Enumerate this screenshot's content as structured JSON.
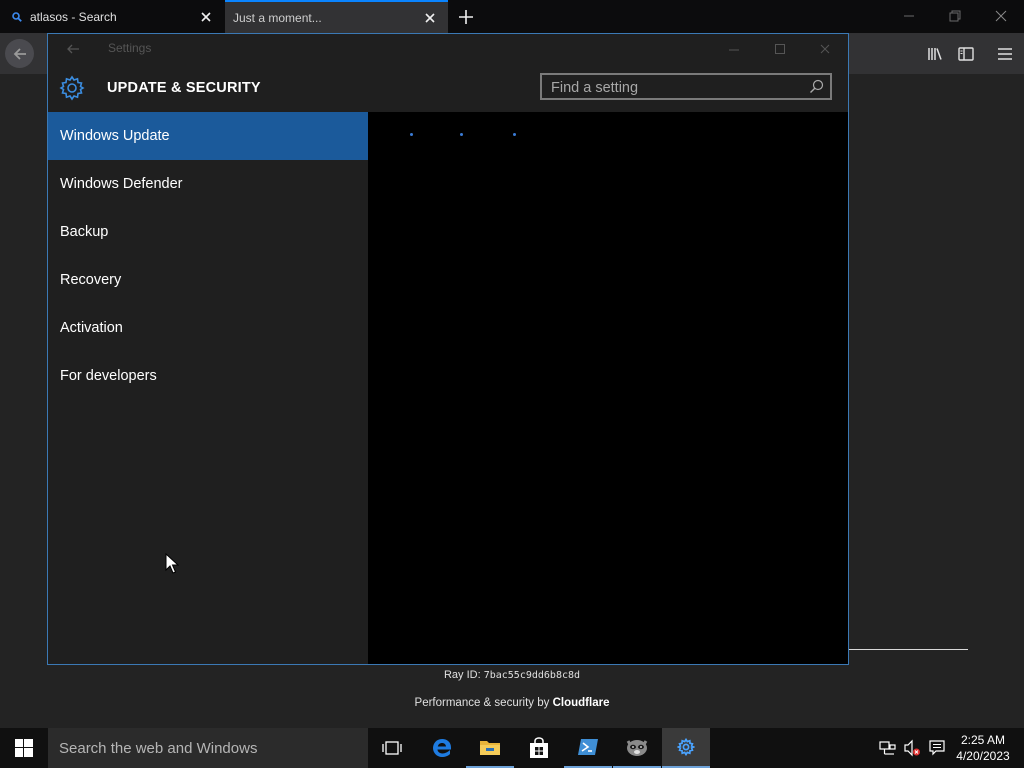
{
  "browser": {
    "tabs": [
      {
        "title": "atlasos - Search"
      },
      {
        "title": "Just a moment..."
      }
    ]
  },
  "page": {
    "ray_label": "Ray ID:",
    "ray_id": "7bac55c9dd6b8c8d",
    "perf_prefix": "Performance & security by",
    "perf_brand": "Cloudflare"
  },
  "settings": {
    "window_title": "Settings",
    "section_title": "UPDATE & SECURITY",
    "search_placeholder": "Find a setting",
    "nav_items": [
      {
        "label": "Windows Update"
      },
      {
        "label": "Windows Defender"
      },
      {
        "label": "Backup"
      },
      {
        "label": "Recovery"
      },
      {
        "label": "Activation"
      },
      {
        "label": "For developers"
      }
    ],
    "accent_color": "#1b5a9b"
  },
  "taskbar": {
    "search_placeholder": "Search the web and Windows",
    "apps": [
      "task-view",
      "edge",
      "file-explorer",
      "store",
      "powershell",
      "firefox",
      "settings"
    ],
    "clock_time": "2:25 AM",
    "clock_date": "4/20/2023"
  }
}
